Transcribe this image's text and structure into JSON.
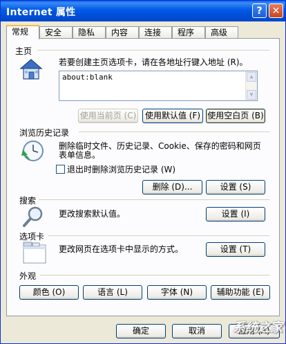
{
  "window": {
    "title": "Internet 属性"
  },
  "titlebar": {
    "help": "?",
    "close": "✕"
  },
  "tabs": [
    "常规",
    "安全",
    "隐私",
    "内容",
    "连接",
    "程序",
    "高级"
  ],
  "home": {
    "section": "主页",
    "instruction": "若要创建主页选项卡，请在各地址行键入地址 (R)。",
    "url": "about:blank",
    "buttons": {
      "current": "使用当前页 (C)",
      "default": "使用默认值 (F)",
      "blank": "使用空白页 (B)"
    }
  },
  "history": {
    "section": "浏览历史记录",
    "desc_line1": "删除临时文件、历史记录、Cookie、保存的密码和网页",
    "desc_line2": "表单信息。",
    "checkbox": "退出时删除浏览历史记录 (W)",
    "checked": false,
    "buttons": {
      "delete": "删除 (D)...",
      "settings": "设置 (S)"
    }
  },
  "search": {
    "section": "搜索",
    "desc": "更改搜索默认值。",
    "settings": "设置 (I)"
  },
  "tabsec": {
    "section": "选项卡",
    "desc": "更改网页在选项卡中显示的方式。",
    "settings": "设置 (T)"
  },
  "appearance": {
    "section": "外观",
    "buttons": {
      "colors": "颜色 (O)",
      "languages": "语言 (L)",
      "fonts": "字体 (N)",
      "accessibility": "辅助功能 (E)"
    }
  },
  "footer": {
    "ok": "确定",
    "cancel": "取消",
    "apply": "应用 (A)"
  },
  "watermark": "系统之家"
}
